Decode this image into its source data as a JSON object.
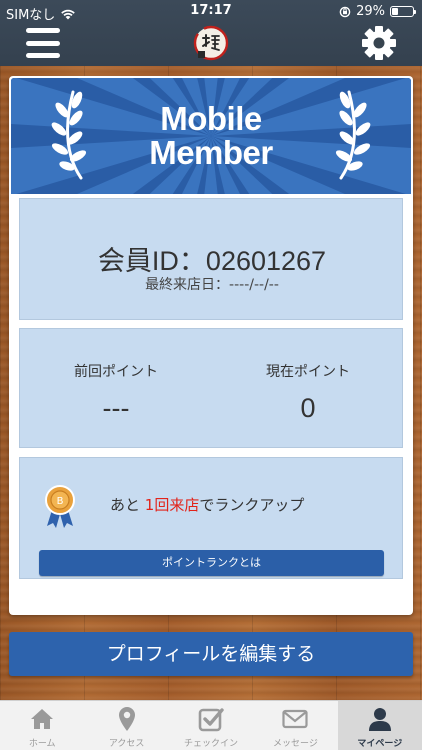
{
  "status_bar": {
    "carrier": "SIMなし",
    "time": "17:17",
    "battery": "29%"
  },
  "header": {
    "menu_icon": "hamburger-menu-icon",
    "logo_icon": "shop-logo-icon",
    "settings_icon": "gear-icon"
  },
  "banner": {
    "line1": "Mobile",
    "line2": "Member"
  },
  "member": {
    "id_text": "会員ID：02601267",
    "last_visit": "最終来店日：----/--/--"
  },
  "points": {
    "previous_label": "前回ポイント",
    "previous_value": "---",
    "current_label": "現在ポイント",
    "current_value": "0"
  },
  "rank": {
    "prefix": "あと ",
    "highlight": "1回来店",
    "suffix": "でランクアップ",
    "button_label": "ポイントランクとは",
    "highlight_color": "#e2231a"
  },
  "edit_profile_label": "プロフィールを編集する",
  "tabs": [
    {
      "label": "ホーム",
      "icon": "home-icon",
      "active": false
    },
    {
      "label": "アクセス",
      "icon": "map-pin-icon",
      "active": false
    },
    {
      "label": "チェックイン",
      "icon": "checkin-icon",
      "active": false
    },
    {
      "label": "メッセージ",
      "icon": "envelope-icon",
      "active": false
    },
    {
      "label": "マイページ",
      "icon": "user-icon",
      "active": true
    }
  ],
  "colors": {
    "header_bg": "#3c4a59",
    "accent_blue": "#2d63ad",
    "panel_bg": "#c7dbf0"
  }
}
